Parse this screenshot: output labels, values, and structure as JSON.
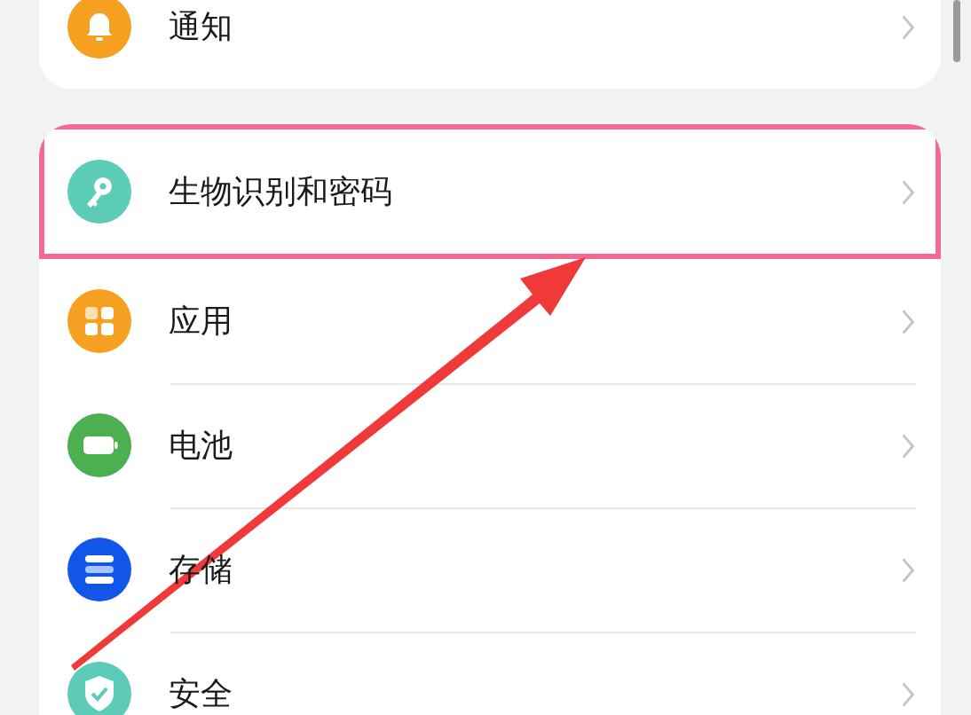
{
  "groups": [
    {
      "rows": [
        {
          "label": "通知",
          "highlighted": false
        }
      ]
    },
    {
      "rows": [
        {
          "label": "生物识别和密码",
          "highlighted": true
        },
        {
          "label": "应用",
          "highlighted": false
        },
        {
          "label": "电池",
          "highlighted": false
        },
        {
          "label": "存储",
          "highlighted": false
        },
        {
          "label": "安全",
          "highlighted": false
        }
      ]
    }
  ]
}
